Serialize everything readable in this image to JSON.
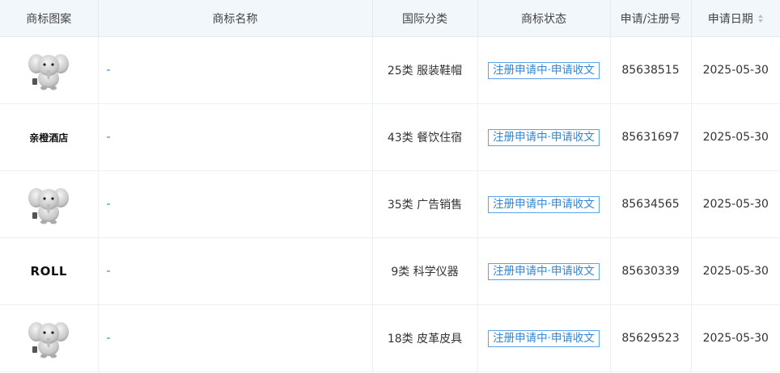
{
  "header": {
    "col_logo": "商标图案",
    "col_name": "商标名称",
    "col_class": "国际分类",
    "col_status": "商标状态",
    "col_regno": "申请/注册号",
    "col_date": "申请日期"
  },
  "rows": [
    {
      "logo_type": "image",
      "logo_icon": "elephant-mascot-icon",
      "logo_text": "",
      "name": "-",
      "class": "25类 服装鞋帽",
      "status": "注册申请中·申请收文",
      "regno": "85638515",
      "date": "2025-05-30"
    },
    {
      "logo_type": "text-small",
      "logo_icon": "",
      "logo_text": "亲橙酒店",
      "name": "-",
      "class": "43类 餐饮住宿",
      "status": "注册申请中·申请收文",
      "regno": "85631697",
      "date": "2025-05-30"
    },
    {
      "logo_type": "image",
      "logo_icon": "elephant-mascot-icon",
      "logo_text": "",
      "name": "-",
      "class": "35类 广告销售",
      "status": "注册申请中·申请收文",
      "regno": "85634565",
      "date": "2025-05-30"
    },
    {
      "logo_type": "text-big",
      "logo_icon": "",
      "logo_text": "ROLL",
      "name": "-",
      "class": "9类 科学仪器",
      "status": "注册申请中·申请收文",
      "regno": "85630339",
      "date": "2025-05-30"
    },
    {
      "logo_type": "image",
      "logo_icon": "elephant-mascot-icon",
      "logo_text": "",
      "name": "-",
      "class": "18类 皮革皮具",
      "status": "注册申请中·申请收文",
      "regno": "85629523",
      "date": "2025-05-30"
    }
  ],
  "colors": {
    "header_bg": "#f2f7fb",
    "status_border": "#5aa3e6",
    "status_text": "#2f86d6",
    "name_dash": "#2e7bc6"
  },
  "icons": {
    "sort": "sort-caret-icon",
    "mascot": "elephant-mascot-icon"
  }
}
